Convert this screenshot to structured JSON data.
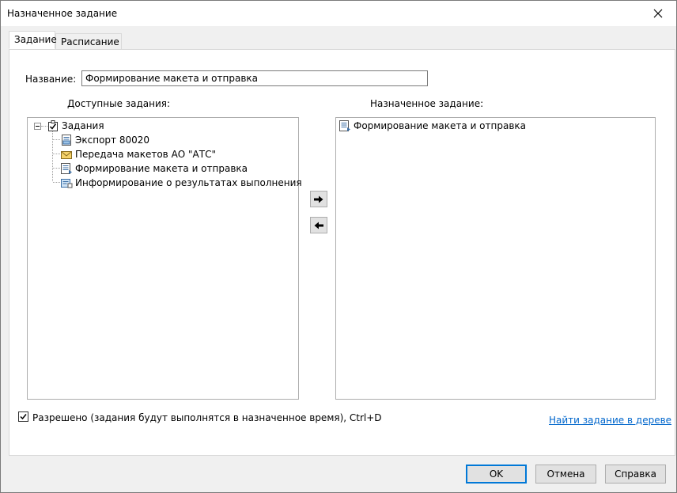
{
  "window": {
    "title": "Назначенное задание"
  },
  "tabs": [
    {
      "label": "Задание",
      "active": true
    },
    {
      "label": "Расписание",
      "active": false
    }
  ],
  "form": {
    "name_label": "Название:",
    "name_value": "Формирование макета и отправка"
  },
  "available": {
    "label": "Доступные задания:",
    "root": {
      "label": "Задания",
      "icon": "checked-folder-icon",
      "expanded": true
    },
    "items": [
      {
        "label": "Экспорт 80020",
        "icon": "document-export-icon"
      },
      {
        "label": "Передача макетов АО \"АТС\"",
        "icon": "envelope-icon"
      },
      {
        "label": "Формирование макета и отправка",
        "icon": "document-list-icon"
      },
      {
        "label": "Информирование о результатах выполнения",
        "icon": "notification-icon"
      }
    ]
  },
  "assigned": {
    "label": "Назначенное задание:",
    "items": [
      {
        "label": "Формирование макета и отправка",
        "icon": "document-list-icon"
      }
    ]
  },
  "transfer": {
    "add_icon": "arrow-right-icon",
    "remove_icon": "arrow-left-icon"
  },
  "enabled": {
    "label": "Разрешено (задания будут выполнятся в назначенное время), Ctrl+D",
    "checked": true
  },
  "find_link": "Найти задание в дереве",
  "buttons": {
    "ok": "OK",
    "cancel": "Отмена",
    "help": "Справка"
  },
  "colors": {
    "default_button_border": "#0078d7",
    "link": "#0066cc"
  }
}
